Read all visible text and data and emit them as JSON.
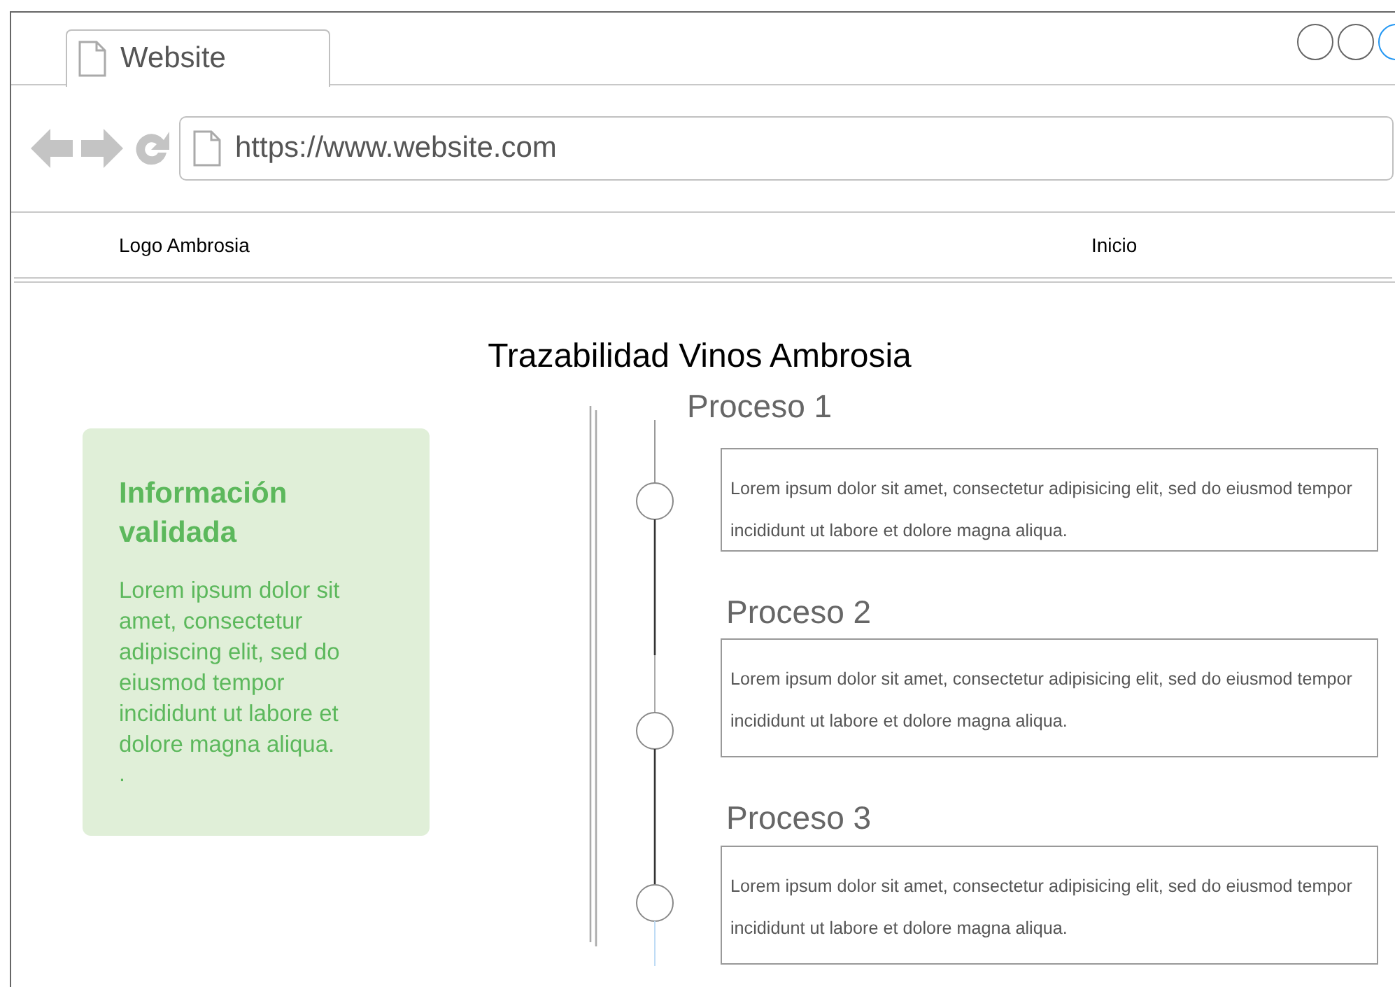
{
  "browser": {
    "tab_title": "Website",
    "url": "https://www.website.com"
  },
  "nav": {
    "logo": "Logo Ambrosia",
    "links": [
      "Inicio"
    ]
  },
  "page_title": "Trazabilidad Vinos Ambrosia",
  "info_card": {
    "title": "Información validada",
    "text": "Lorem ipsum dolor sit amet, consectetur adipiscing elit, sed do eiusmod tempor incididunt ut labore et dolore magna aliqua.",
    "footnote": "."
  },
  "processes": [
    {
      "title": "Proceso 1",
      "text": "Lorem ipsum dolor sit amet, consectetur adipisicing elit, sed do eiusmod tempor incididunt ut labore et dolore magna aliqua."
    },
    {
      "title": "Proceso 2",
      "text": "Lorem ipsum dolor sit amet, consectetur adipisicing elit, sed do eiusmod tempor incididunt ut labore et dolore magna aliqua."
    },
    {
      "title": "Proceso 3",
      "text": "Lorem ipsum dolor sit amet, consectetur adipisicing elit, sed do eiusmod tempor incididunt ut labore et dolore magna aliqua."
    }
  ]
}
